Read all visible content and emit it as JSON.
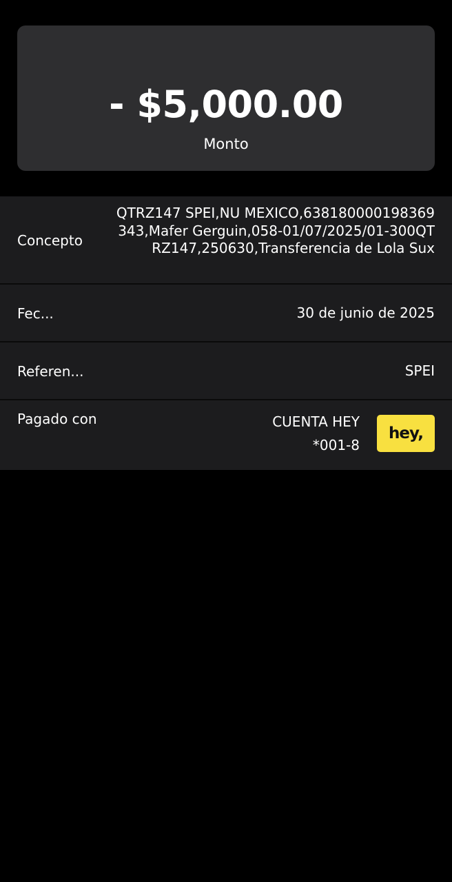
{
  "amount": {
    "value": "- $5,000.00",
    "label": "Monto"
  },
  "details": {
    "concepto": {
      "label": "Concepto",
      "value": "QTRZ147 SPEI,NU MEXICO,638180000198369343,Mafer Gerguin,058-01/07/2025/01-300QTRZ147,250630,Transferencia de Lola Sux"
    },
    "fecha": {
      "label": "Fec...",
      "value": "30 de junio de 2025"
    },
    "referencia": {
      "label": "Referen...",
      "value": "SPEI"
    },
    "pagado": {
      "label": "Pagado con",
      "account_name": "CUENTA HEY",
      "account_number": "*001-8",
      "logo_text": "hey,"
    }
  },
  "colors": {
    "background": "#000000",
    "card": "#2e2e30",
    "rows": "#1c1c1e",
    "brand": "#f8e040"
  }
}
